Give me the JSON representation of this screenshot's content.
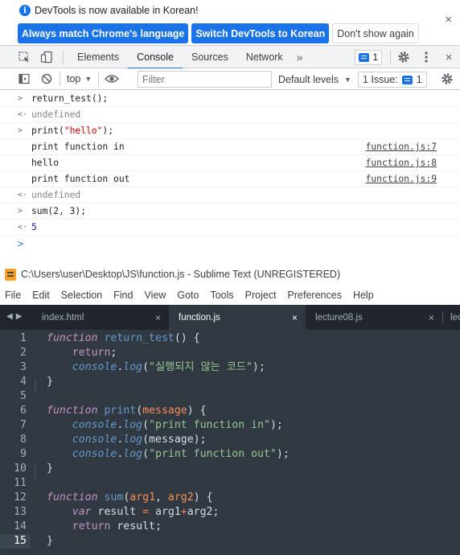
{
  "infobar": {
    "message": "DevTools is now available in Korean!",
    "btn_match": "Always match Chrome's language",
    "btn_switch": "Switch DevTools to Korean",
    "btn_dismiss": "Don't show again",
    "close": "×"
  },
  "devtools_tabs": [
    "Elements",
    "Console",
    "Sources",
    "Network"
  ],
  "devtools_active_tab": "Console",
  "more_tabs": "»",
  "issues_badge_count": "1",
  "filterbar": {
    "context": "top",
    "filter_placeholder": "Filter",
    "levels": "Default levels",
    "issues_label": "1 Issue:",
    "issues_count": "1"
  },
  "console": {
    "lines": [
      {
        "type": "input",
        "prefix": ">",
        "text": "return_test();"
      },
      {
        "type": "result",
        "prefix": "<·",
        "text": "undefined"
      },
      {
        "type": "input",
        "prefix": ">",
        "pre": "print(",
        "str": "\"hello\"",
        "post": ");"
      },
      {
        "type": "log",
        "text": "print function in",
        "source": "function.js:7"
      },
      {
        "type": "log",
        "text": "hello",
        "source": "function.js:8"
      },
      {
        "type": "log",
        "text": "print function out",
        "source": "function.js:9"
      },
      {
        "type": "result",
        "prefix": "<·",
        "text": "undefined"
      },
      {
        "type": "input",
        "prefix": ">",
        "text": "sum(2, 3);"
      },
      {
        "type": "number",
        "prefix": "<·",
        "text": "5"
      }
    ],
    "prompt": ">"
  },
  "sublime": {
    "title": "C:\\Users\\user\\Desktop\\JS\\function.js - Sublime Text (UNREGISTERED)",
    "menu": [
      "File",
      "Edit",
      "Selection",
      "Find",
      "View",
      "Goto",
      "Tools",
      "Project",
      "Preferences",
      "Help"
    ],
    "tabs": [
      {
        "label": "index.html"
      },
      {
        "label": "function.js",
        "active": true
      },
      {
        "label": "lecture08.js"
      },
      {
        "label": "lec"
      }
    ],
    "tab_close": "×",
    "line_numbers": [
      "1",
      "2",
      "3",
      "4",
      "5",
      "6",
      "7",
      "8",
      "9",
      "10",
      "11",
      "12",
      "13",
      "14",
      "15"
    ],
    "current_line": "15",
    "code": {
      "l1_kw": "function",
      "l1_name": "return_test",
      "l1_rest": "() {",
      "l2_kw": "return",
      "l2_rest": ";",
      "l3_obj": "console",
      "l3_dot": ".",
      "l3_fn": "log",
      "l3_open": "(",
      "l3_str": "\"실행되지 않는 코드\"",
      "l3_close": ");",
      "l4": "}",
      "l6_kw": "function",
      "l6_name": "print",
      "l6_open": "(",
      "l6_param": "message",
      "l6_rest": ") {",
      "l7_obj": "console",
      "l7_dot": ".",
      "l7_fn": "log",
      "l7_open": "(",
      "l7_str": "\"print function in\"",
      "l7_close": ");",
      "l8_obj": "console",
      "l8_dot": ".",
      "l8_fn": "log",
      "l8_rest": "(message);",
      "l9_obj": "console",
      "l9_dot": ".",
      "l9_fn": "log",
      "l9_open": "(",
      "l9_str": "\"print function out\"",
      "l9_close": ");",
      "l10": "}",
      "l12_kw": "function",
      "l12_name": "sum",
      "l12_open": "(",
      "l12_p1": "arg1",
      "l12_comma": ", ",
      "l12_p2": "arg2",
      "l12_rest": ") {",
      "l13_kw": "var",
      "l13_mid": " result ",
      "l13_eq": "=",
      "l13_a": " arg1",
      "l13_plus": "+",
      "l13_b": "arg2;",
      "l14_kw": "return",
      "l14_rest": " result;",
      "l15": "}"
    }
  }
}
